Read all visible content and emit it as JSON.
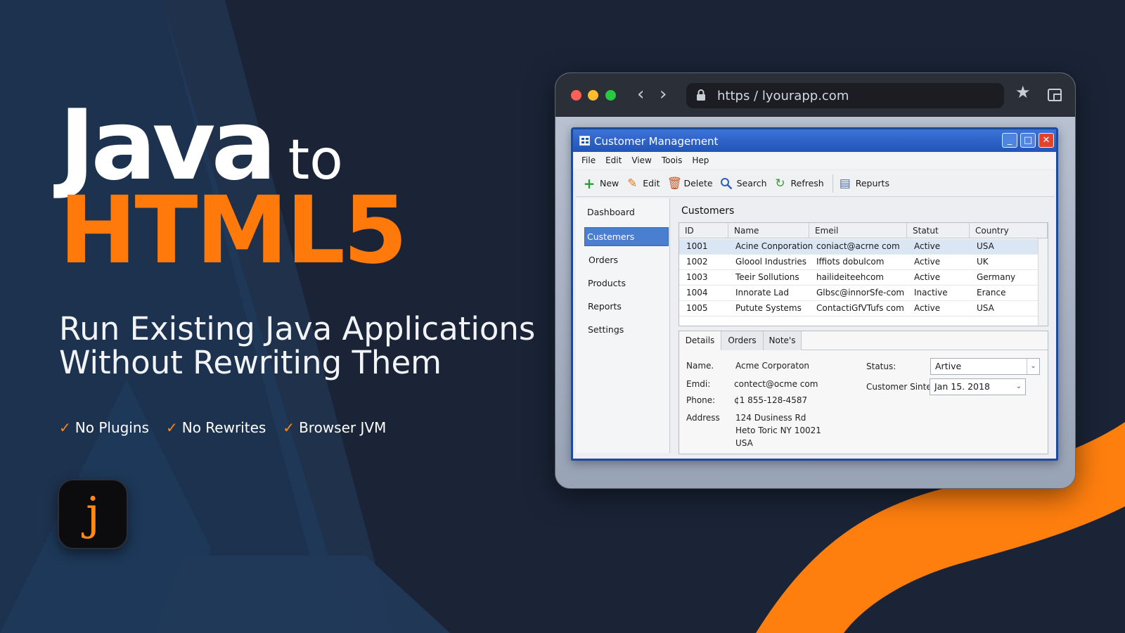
{
  "hero": {
    "java": "Java",
    "to": "to",
    "html5": "HTML5",
    "subtitle_line1": "Run Existing Java Applications",
    "subtitle_line2": "Without Rewriting Them",
    "features": [
      "No Plugins",
      "No Rewrites",
      "Browser JVM"
    ],
    "logo_letter": "j"
  },
  "colors": {
    "background": "#1a2436",
    "accent_orange": "#ff8a1a",
    "titlebar_blue": "#2155b8"
  },
  "browser": {
    "url": "https / lyourapp.com",
    "icons": [
      "close-dot",
      "minimize-dot",
      "maximize-dot",
      "back-icon",
      "forward-icon",
      "lock-icon",
      "star-icon",
      "tabs-icon"
    ]
  },
  "window": {
    "title": "Customer Management",
    "controls": {
      "minimize": "_",
      "maximize": "□",
      "close": "✕"
    },
    "menu": [
      "File",
      "Edit",
      "View",
      "Toois",
      "Hep"
    ],
    "toolbar": {
      "new": "New",
      "edit": "Edit",
      "delete": "Delete",
      "search": "Search",
      "refresh": "Refresh",
      "reports": "Repurts"
    },
    "sidebar": [
      "Dashboard",
      "Custemers",
      "Orders",
      "Products",
      "Reports",
      "Settings"
    ],
    "main_title": "Customers",
    "table": {
      "headers": [
        "ID",
        "Name",
        "Emeil",
        "Statut",
        "Country"
      ],
      "rows": [
        [
          "1001",
          "Acine Conporation",
          "coniact@acrne com",
          "Active",
          "USA"
        ],
        [
          "1002",
          "Gloool Industries",
          "Iffiots dobulcom",
          "Active",
          "UK"
        ],
        [
          "1003",
          "Teeir Sollutions",
          "hailideiteehcom",
          "Active",
          "Germany"
        ],
        [
          "1004",
          "Innorate Lad",
          "Glbsc@innorSfe-com",
          "Inactive",
          "Erance"
        ],
        [
          "1005",
          "Putute Systems",
          "ContactiGfVTufs com",
          "Active",
          "USA"
        ]
      ]
    },
    "details": {
      "tabs": [
        "Details",
        "Orders",
        "Note's"
      ],
      "name_label": "Name.",
      "name_value": "Acme Corporaton",
      "email_label": "Emdi:",
      "email_value": "contect@ocme com",
      "phone_label": "Phone:",
      "phone_value": "¢1 855-128-4587",
      "address_label": "Address",
      "address_line1": "124 Dusiness Rd",
      "address_line2": "Heto Toric NY 10021",
      "address_line3": "USA",
      "status_label": "Status:",
      "status_value": "Artive",
      "since_label": "Customer Sinte",
      "since_value": "Jan 15. 2018"
    }
  }
}
